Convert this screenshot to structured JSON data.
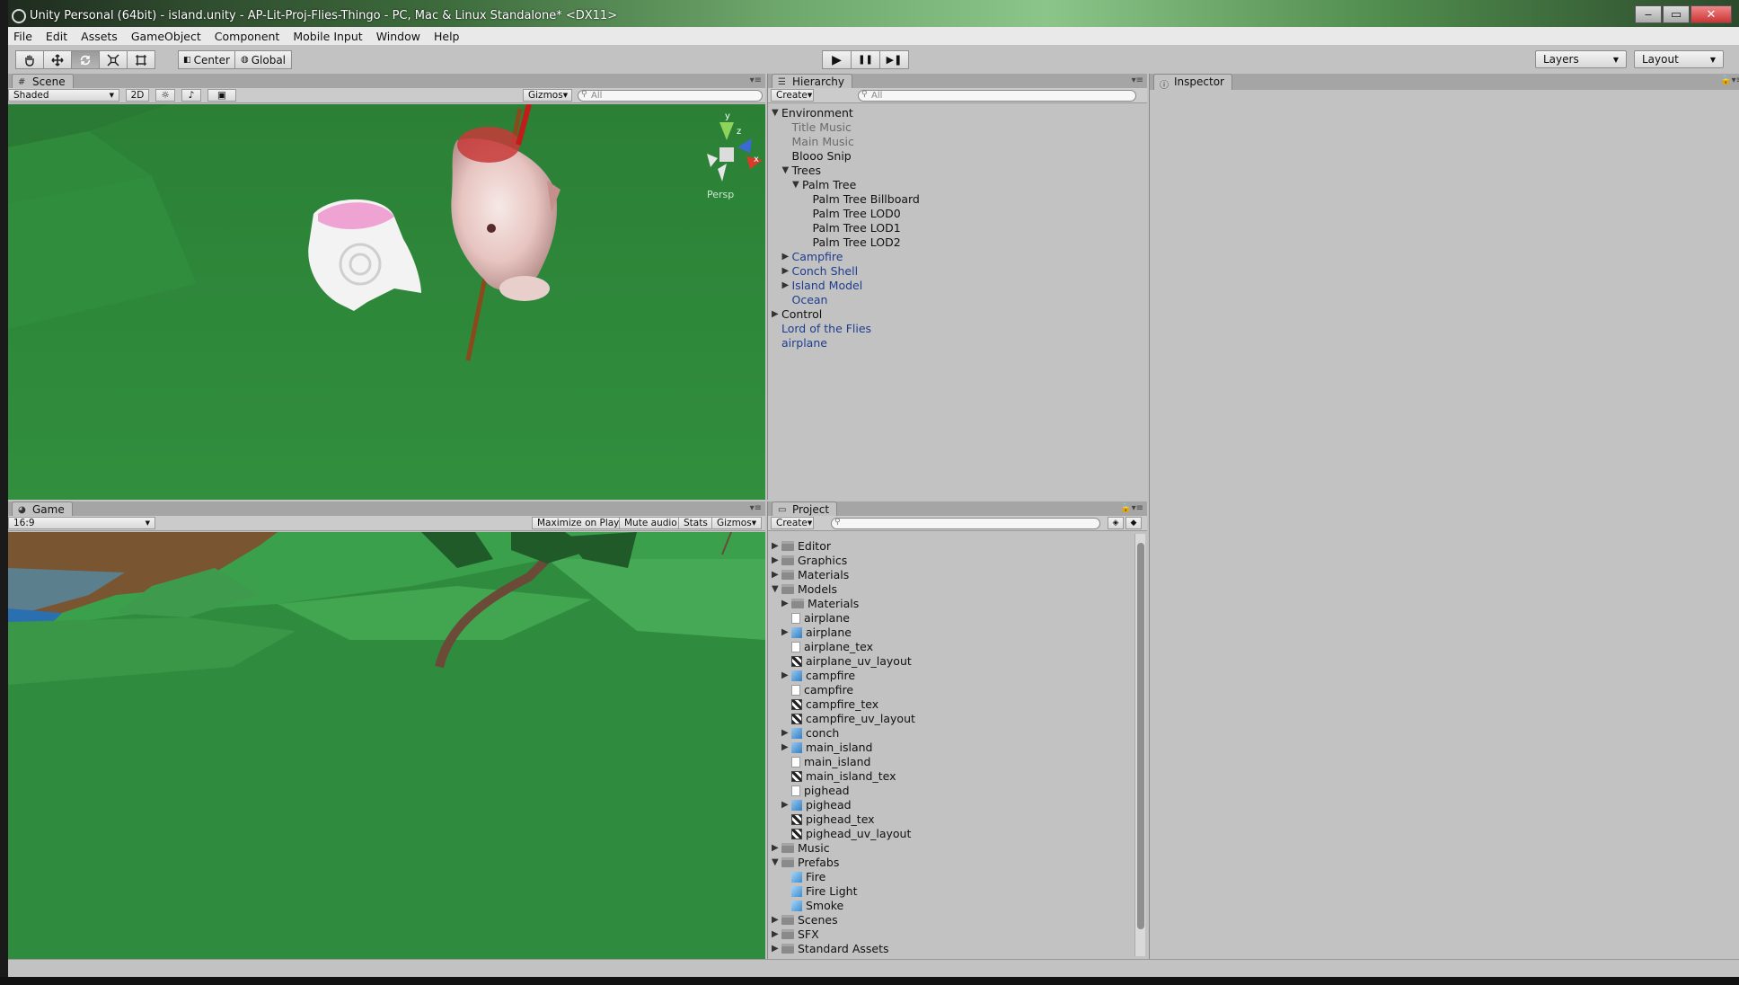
{
  "window": {
    "title": "Unity Personal (64bit) - island.unity - AP-Lit-Proj-Flies-Thingo - PC, Mac & Linux Standalone* <DX11>",
    "icon": "unity-icon",
    "buttons": {
      "minimize": "‒",
      "maximize": "▭",
      "close": "✕"
    }
  },
  "menu": [
    "File",
    "Edit",
    "Assets",
    "GameObject",
    "Component",
    "Mobile Input",
    "Window",
    "Help"
  ],
  "toolbar": {
    "tools": [
      "hand-icon",
      "move-icon",
      "rotate-icon",
      "scale-icon",
      "rect-icon"
    ],
    "pivot": "Center",
    "space": "Global",
    "play_icon": "▶",
    "pause_icon": "❚❚",
    "step_icon": "▶❚",
    "layers": "Layers",
    "layout": "Layout"
  },
  "scene": {
    "tab": "Scene",
    "shading": "Shaded",
    "mode_2d": "2D",
    "gizmos": "Gizmos",
    "search_placeholder": "All",
    "persp": "Persp",
    "axis_y": "y",
    "axis_z": "z",
    "axis_x": "x"
  },
  "game": {
    "tab": "Game",
    "aspect": "16:9",
    "maximize": "Maximize on Play",
    "mute": "Mute audio",
    "stats": "Stats",
    "gizmos": "Gizmos"
  },
  "hierarchy": {
    "tab": "Hierarchy",
    "create": "Create",
    "search_placeholder": "All",
    "items": [
      {
        "label": "Environment",
        "depth": 0,
        "arrow": "down",
        "style": "normal"
      },
      {
        "label": "Title Music",
        "depth": 1,
        "arrow": "none",
        "style": "dim"
      },
      {
        "label": "Main Music",
        "depth": 1,
        "arrow": "none",
        "style": "dim"
      },
      {
        "label": "Blooo Snip",
        "depth": 1,
        "arrow": "none",
        "style": "normal"
      },
      {
        "label": "Trees",
        "depth": 1,
        "arrow": "down",
        "style": "normal"
      },
      {
        "label": "Palm Tree",
        "depth": 2,
        "arrow": "down",
        "style": "normal"
      },
      {
        "label": "Palm Tree Billboard",
        "depth": 3,
        "arrow": "none",
        "style": "normal"
      },
      {
        "label": "Palm Tree LOD0",
        "depth": 3,
        "arrow": "none",
        "style": "normal"
      },
      {
        "label": "Palm Tree LOD1",
        "depth": 3,
        "arrow": "none",
        "style": "normal"
      },
      {
        "label": "Palm Tree LOD2",
        "depth": 3,
        "arrow": "none",
        "style": "normal"
      },
      {
        "label": "Campfire",
        "depth": 1,
        "arrow": "right",
        "style": "blue"
      },
      {
        "label": "Conch Shell",
        "depth": 1,
        "arrow": "right",
        "style": "blue"
      },
      {
        "label": "Island Model",
        "depth": 1,
        "arrow": "right",
        "style": "blue"
      },
      {
        "label": "Ocean",
        "depth": 1,
        "arrow": "none",
        "style": "blue"
      },
      {
        "label": "Control",
        "depth": 0,
        "arrow": "right",
        "style": "normal"
      },
      {
        "label": "Lord of the Flies",
        "depth": 0,
        "arrow": "none",
        "style": "blue"
      },
      {
        "label": "airplane",
        "depth": 0,
        "arrow": "none",
        "style": "blue"
      }
    ]
  },
  "project": {
    "tab": "Project",
    "create": "Create",
    "items": [
      {
        "label": "Editor",
        "depth": 0,
        "arrow": "right",
        "icon": "folder"
      },
      {
        "label": "Graphics",
        "depth": 0,
        "arrow": "right",
        "icon": "folder"
      },
      {
        "label": "Materials",
        "depth": 0,
        "arrow": "right",
        "icon": "folder"
      },
      {
        "label": "Models",
        "depth": 0,
        "arrow": "down",
        "icon": "folder"
      },
      {
        "label": "Materials",
        "depth": 1,
        "arrow": "right",
        "icon": "folder"
      },
      {
        "label": "airplane",
        "depth": 1,
        "arrow": "none",
        "icon": "file"
      },
      {
        "label": "airplane",
        "depth": 1,
        "arrow": "right",
        "icon": "mesh"
      },
      {
        "label": "airplane_tex",
        "depth": 1,
        "arrow": "none",
        "icon": "file"
      },
      {
        "label": "airplane_uv_layout",
        "depth": 1,
        "arrow": "none",
        "icon": "tex"
      },
      {
        "label": "campfire",
        "depth": 1,
        "arrow": "right",
        "icon": "mesh"
      },
      {
        "label": "campfire",
        "depth": 1,
        "arrow": "none",
        "icon": "file"
      },
      {
        "label": "campfire_tex",
        "depth": 1,
        "arrow": "none",
        "icon": "tex"
      },
      {
        "label": "campfire_uv_layout",
        "depth": 1,
        "arrow": "none",
        "icon": "tex"
      },
      {
        "label": "conch",
        "depth": 1,
        "arrow": "right",
        "icon": "mesh"
      },
      {
        "label": "main_island",
        "depth": 1,
        "arrow": "right",
        "icon": "mesh"
      },
      {
        "label": "main_island",
        "depth": 1,
        "arrow": "none",
        "icon": "file"
      },
      {
        "label": "main_island_tex",
        "depth": 1,
        "arrow": "none",
        "icon": "tex"
      },
      {
        "label": "pighead",
        "depth": 1,
        "arrow": "none",
        "icon": "file"
      },
      {
        "label": "pighead",
        "depth": 1,
        "arrow": "right",
        "icon": "mesh"
      },
      {
        "label": "pighead_tex",
        "depth": 1,
        "arrow": "none",
        "icon": "tex"
      },
      {
        "label": "pighead_uv_layout",
        "depth": 1,
        "arrow": "none",
        "icon": "tex"
      },
      {
        "label": "Music",
        "depth": 0,
        "arrow": "right",
        "icon": "folder"
      },
      {
        "label": "Prefabs",
        "depth": 0,
        "arrow": "down",
        "icon": "folder"
      },
      {
        "label": "Fire",
        "depth": 1,
        "arrow": "none",
        "icon": "prefab"
      },
      {
        "label": "Fire Light",
        "depth": 1,
        "arrow": "none",
        "icon": "prefab"
      },
      {
        "label": "Smoke",
        "depth": 1,
        "arrow": "none",
        "icon": "prefab"
      },
      {
        "label": "Scenes",
        "depth": 0,
        "arrow": "right",
        "icon": "folder"
      },
      {
        "label": "SFX",
        "depth": 0,
        "arrow": "right",
        "icon": "folder"
      },
      {
        "label": "Standard Assets",
        "depth": 0,
        "arrow": "right",
        "icon": "folder"
      }
    ]
  },
  "inspector": {
    "tab": "Inspector"
  }
}
